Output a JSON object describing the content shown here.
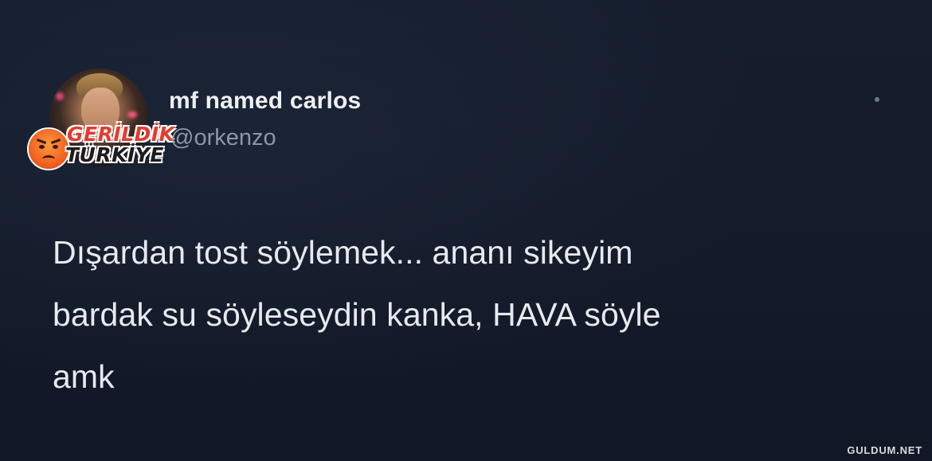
{
  "tweet": {
    "display_name": "mf named carlos",
    "handle": "@orkenzo",
    "text_lines": [
      "Dışardan tost söylemek... ananı sikeyim",
      "bardak su söyleseydin kanka, HAVA söyle",
      "amk"
    ],
    "more_icon": "dot-menu-icon"
  },
  "overlay_badge": {
    "line1": "GERİLDİK",
    "line2": "TÜRKİYE",
    "icon": "angry-face-icon",
    "colors": {
      "line1": "#e63a2e",
      "line2": "#1d1b1b",
      "face": "#ef5a1d"
    }
  },
  "site_watermark": "GULDUM.NET",
  "colors": {
    "background": "#141c2b",
    "text_primary": "#e7eaee",
    "text_secondary": "#8d97a4"
  }
}
